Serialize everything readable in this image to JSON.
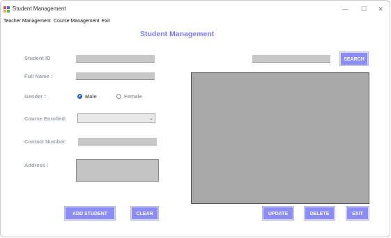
{
  "window": {
    "title": "Student Management",
    "controls": [
      "—",
      "☐",
      "✕"
    ]
  },
  "menu": {
    "items": [
      "Teacher Management",
      "Course Management",
      "Exit"
    ]
  },
  "heading": "Student Management",
  "form": {
    "student_id_label": "Student ID",
    "full_name_label": "Full Name :",
    "gender_label": "Gender :",
    "gender_options": [
      "Male",
      "Female"
    ],
    "gender_selected": "Male",
    "course_label": "Course Enrolled:",
    "contact_label": "Contact Number:",
    "address_label": "Address :"
  },
  "buttons": {
    "search": "SEARCH",
    "add_student": "ADD  STUDENT",
    "clear": "CLEAR",
    "update": "UPDATE",
    "delete": "DELETE",
    "exit": "EXIT"
  },
  "colors": {
    "accent": "#8c8cf5",
    "heading": "#7b7bf0",
    "field": "#c8c8c8",
    "grid": "#a8a8a8"
  },
  "icons": {
    "app": "student-management-icon",
    "combo_arrow": "chevron-down-icon"
  }
}
